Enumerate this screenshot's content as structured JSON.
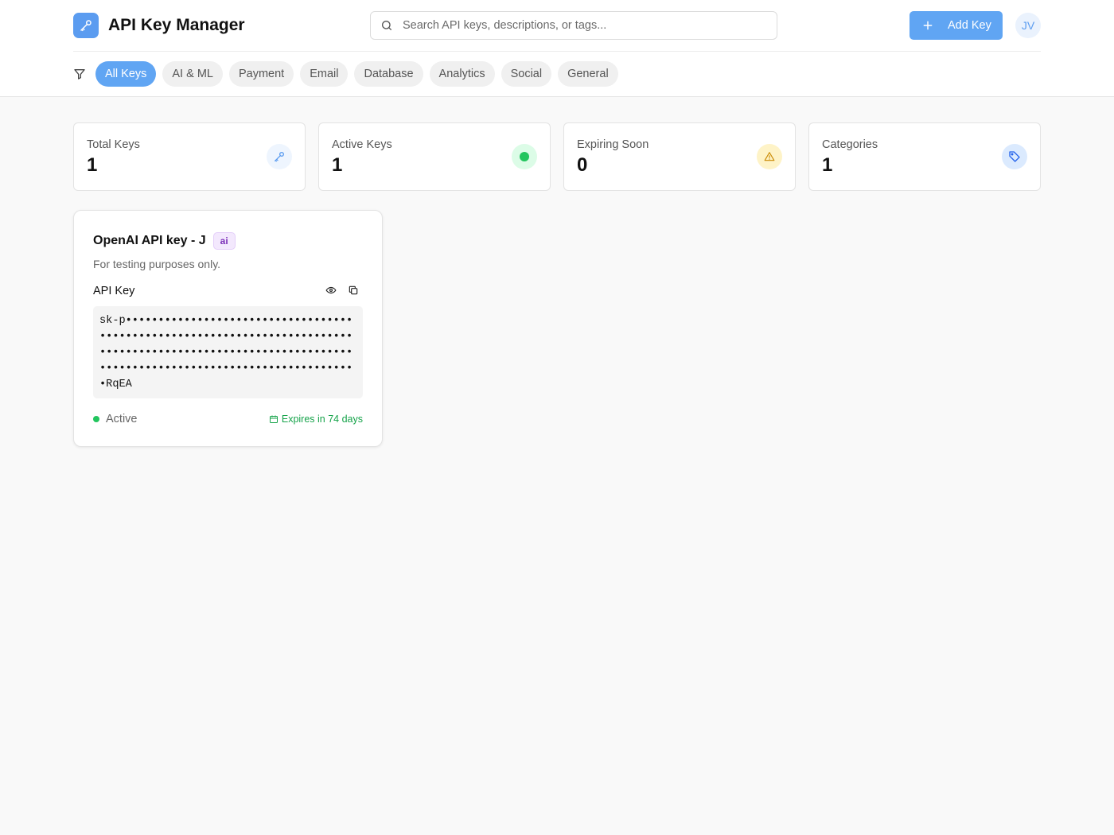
{
  "header": {
    "title": "API Key Manager",
    "search_placeholder": "Search API keys, descriptions, or tags...",
    "add_button_label": "Add Key",
    "avatar_initials": "JV"
  },
  "filters": {
    "items": [
      {
        "label": "All Keys",
        "active": true
      },
      {
        "label": "AI & ML",
        "active": false
      },
      {
        "label": "Payment",
        "active": false
      },
      {
        "label": "Email",
        "active": false
      },
      {
        "label": "Database",
        "active": false
      },
      {
        "label": "Analytics",
        "active": false
      },
      {
        "label": "Social",
        "active": false
      },
      {
        "label": "General",
        "active": false
      }
    ]
  },
  "stats": [
    {
      "label": "Total Keys",
      "value": "1",
      "icon": "key-icon",
      "color": "#5b9cf0"
    },
    {
      "label": "Active Keys",
      "value": "1",
      "icon": "active-dot-icon",
      "color": "#22c55e"
    },
    {
      "label": "Expiring Soon",
      "value": "0",
      "icon": "warning-icon",
      "color": "#ca8a04"
    },
    {
      "label": "Categories",
      "value": "1",
      "icon": "tag-icon",
      "color": "#2563eb"
    }
  ],
  "keys": [
    {
      "name": "OpenAI API key - J",
      "tag": "ai",
      "description": "For testing purposes only.",
      "key_label": "API Key",
      "masked_key": "sk-p•••••••••••••••••••••••••••••••••••••••••••••••••••••••••••••••••••••••••••••••••••••••••••••••••••••••••••••••••••••••••••••••••••••••••••••••••••••••••RqEA",
      "status": "Active",
      "expires": "Expires in 74 days"
    }
  ],
  "colors": {
    "accent": "#60a5f3",
    "active_green": "#22c55e",
    "expires_green": "#16a34a",
    "tag_purple": "#7a2fb8"
  }
}
